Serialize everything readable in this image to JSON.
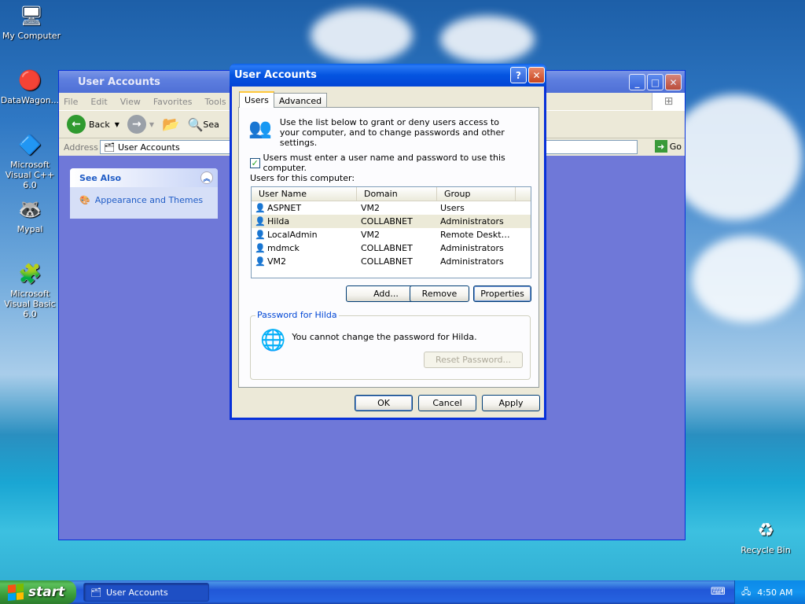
{
  "desktop": {
    "icons": [
      {
        "label": "My Computer",
        "icon": "my-computer-icon",
        "glyph": "🖥"
      },
      {
        "label": "DataWagon...",
        "icon": "datawagon-icon",
        "glyph": "🔴"
      },
      {
        "label": "Microsoft Visual C++ 6.0",
        "icon": "visual-cpp-icon",
        "glyph": "🔷"
      },
      {
        "label": "Mypal",
        "icon": "mypal-icon",
        "glyph": "🦝"
      },
      {
        "label": "Microsoft Visual Basic 6.0",
        "icon": "visual-basic-icon",
        "glyph": "🧩"
      },
      {
        "label": "Recycle Bin",
        "icon": "recycle-bin-icon",
        "glyph": "♻"
      }
    ]
  },
  "explorer": {
    "title": "User Accounts",
    "menu": [
      "File",
      "Edit",
      "View",
      "Favorites",
      "Tools"
    ],
    "toolbar": {
      "back": "Back",
      "search": "Sea"
    },
    "address_label": "Address",
    "address_value": "User Accounts",
    "go_label": "Go",
    "see_also": {
      "title": "See Also",
      "item": "Appearance and Themes"
    }
  },
  "dialog": {
    "title": "User Accounts",
    "tabs": [
      "Users",
      "Advanced"
    ],
    "intro": "Use the list below to grant or deny users access to your computer, and to change passwords and other settings.",
    "require_password_label": "Users must enter a user name and password to use this computer.",
    "require_password_checked": true,
    "users_label": "Users for this computer:",
    "columns": [
      "User Name",
      "Domain",
      "Group"
    ],
    "users": [
      {
        "name": "ASPNET",
        "domain": "VM2",
        "group": "Users"
      },
      {
        "name": "Hilda",
        "domain": "COLLABNET",
        "group": "Administrators"
      },
      {
        "name": "LocalAdmin",
        "domain": "VM2",
        "group": "Remote Deskto..."
      },
      {
        "name": "mdmck",
        "domain": "COLLABNET",
        "group": "Administrators"
      },
      {
        "name": "VM2",
        "domain": "COLLABNET",
        "group": "Administrators"
      }
    ],
    "selected_user": "Hilda",
    "buttons": {
      "add": "Add...",
      "remove": "Remove",
      "properties": "Properties"
    },
    "password_group_title": "Password for Hilda",
    "password_message": "You cannot change the password for Hilda.",
    "reset_password": "Reset Password...",
    "ok": "OK",
    "cancel": "Cancel",
    "apply": "Apply"
  },
  "taskbar": {
    "start": "start",
    "task": "User Accounts",
    "clock": "4:50 AM"
  }
}
